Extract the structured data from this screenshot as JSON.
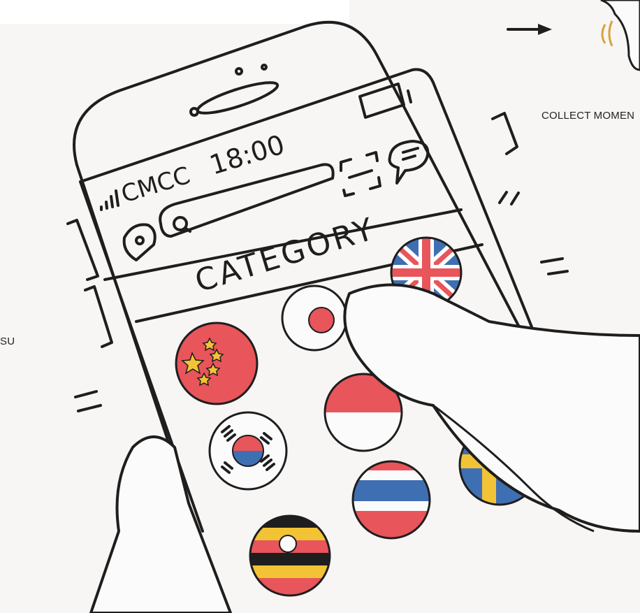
{
  "phone": {
    "carrier": "CMCC",
    "time": "18:00",
    "heading": "CATEGORY"
  },
  "captions": {
    "left": "SU",
    "right": "COLLECT MOMEN"
  },
  "flags": [
    "china",
    "japan",
    "united-kingdom",
    "indonesia",
    "south-korea",
    "sweden",
    "thailand",
    "uganda"
  ],
  "colors": {
    "ink": "#1e1e1e",
    "red": "#e8555a",
    "blue": "#3f6fb3",
    "yellow": "#f2c334",
    "gold": "#d9a23a"
  }
}
